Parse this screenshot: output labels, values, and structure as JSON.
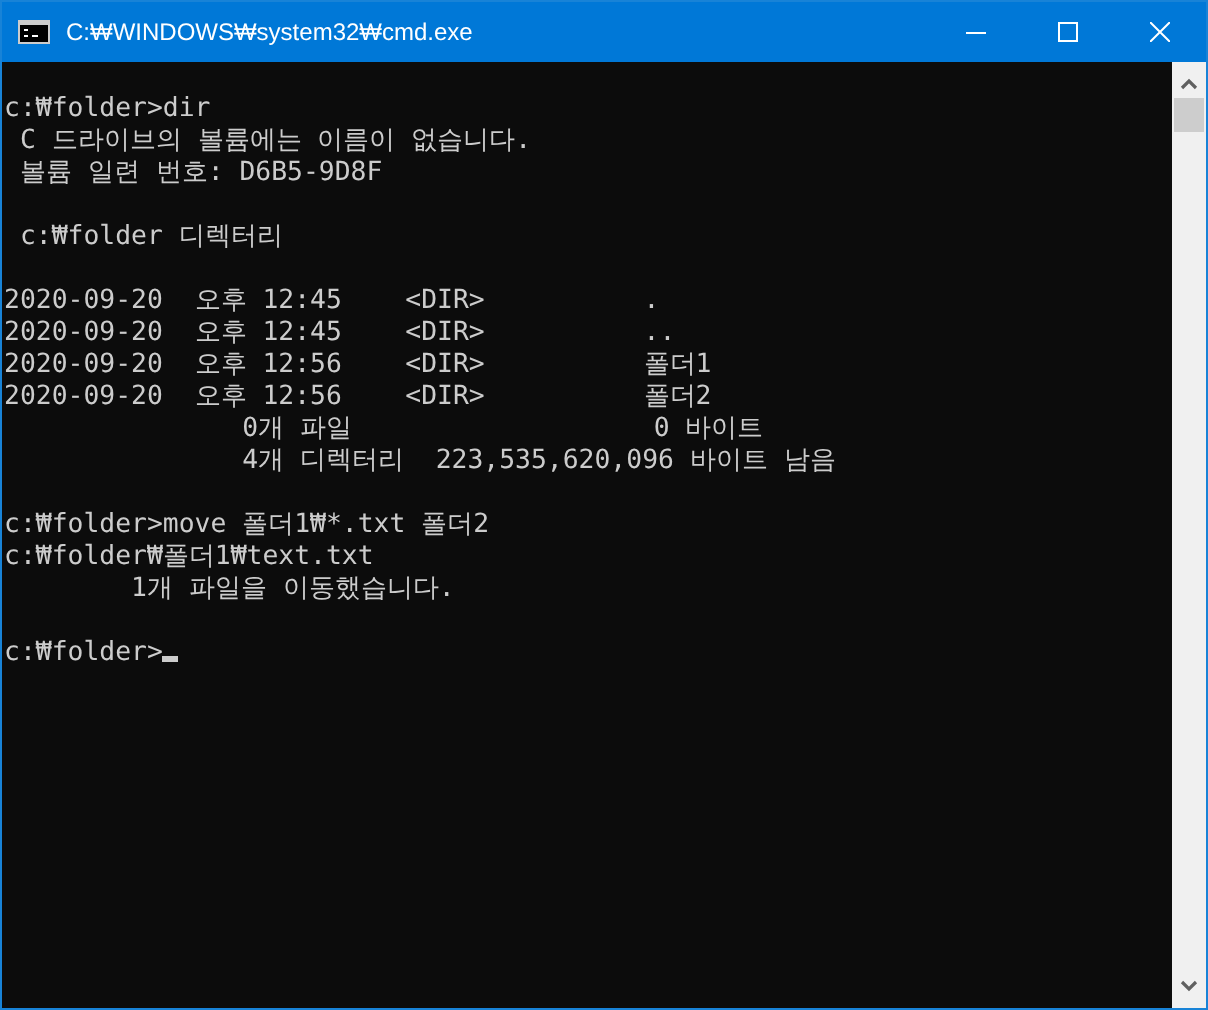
{
  "window": {
    "title": "C:₩WINDOWS₩system32₩cmd.exe"
  },
  "console": {
    "cursor": true,
    "blocks": [
      [
        "c:₩folder>dir",
        " C 드라이브의 볼륨에는 이름이 없습니다.",
        " 볼륨 일련 번호: D6B5-9D8F"
      ],
      [
        " c:₩folder 디렉터리"
      ],
      [
        "2020-09-20  오후 12:45    <DIR>          .",
        "2020-09-20  오후 12:45    <DIR>          ..",
        "2020-09-20  오후 12:56    <DIR>          폴더1",
        "2020-09-20  오후 12:56    <DIR>          폴더2",
        "               0개 파일                   0 바이트",
        "               4개 디렉터리  223,535,620,096 바이트 남음"
      ],
      [
        "c:₩folder>move 폴더1₩*.txt 폴더2",
        "c:₩folder₩폴더1₩text.txt",
        "        1개 파일을 이동했습니다."
      ],
      [
        "c:₩folder>"
      ]
    ]
  }
}
